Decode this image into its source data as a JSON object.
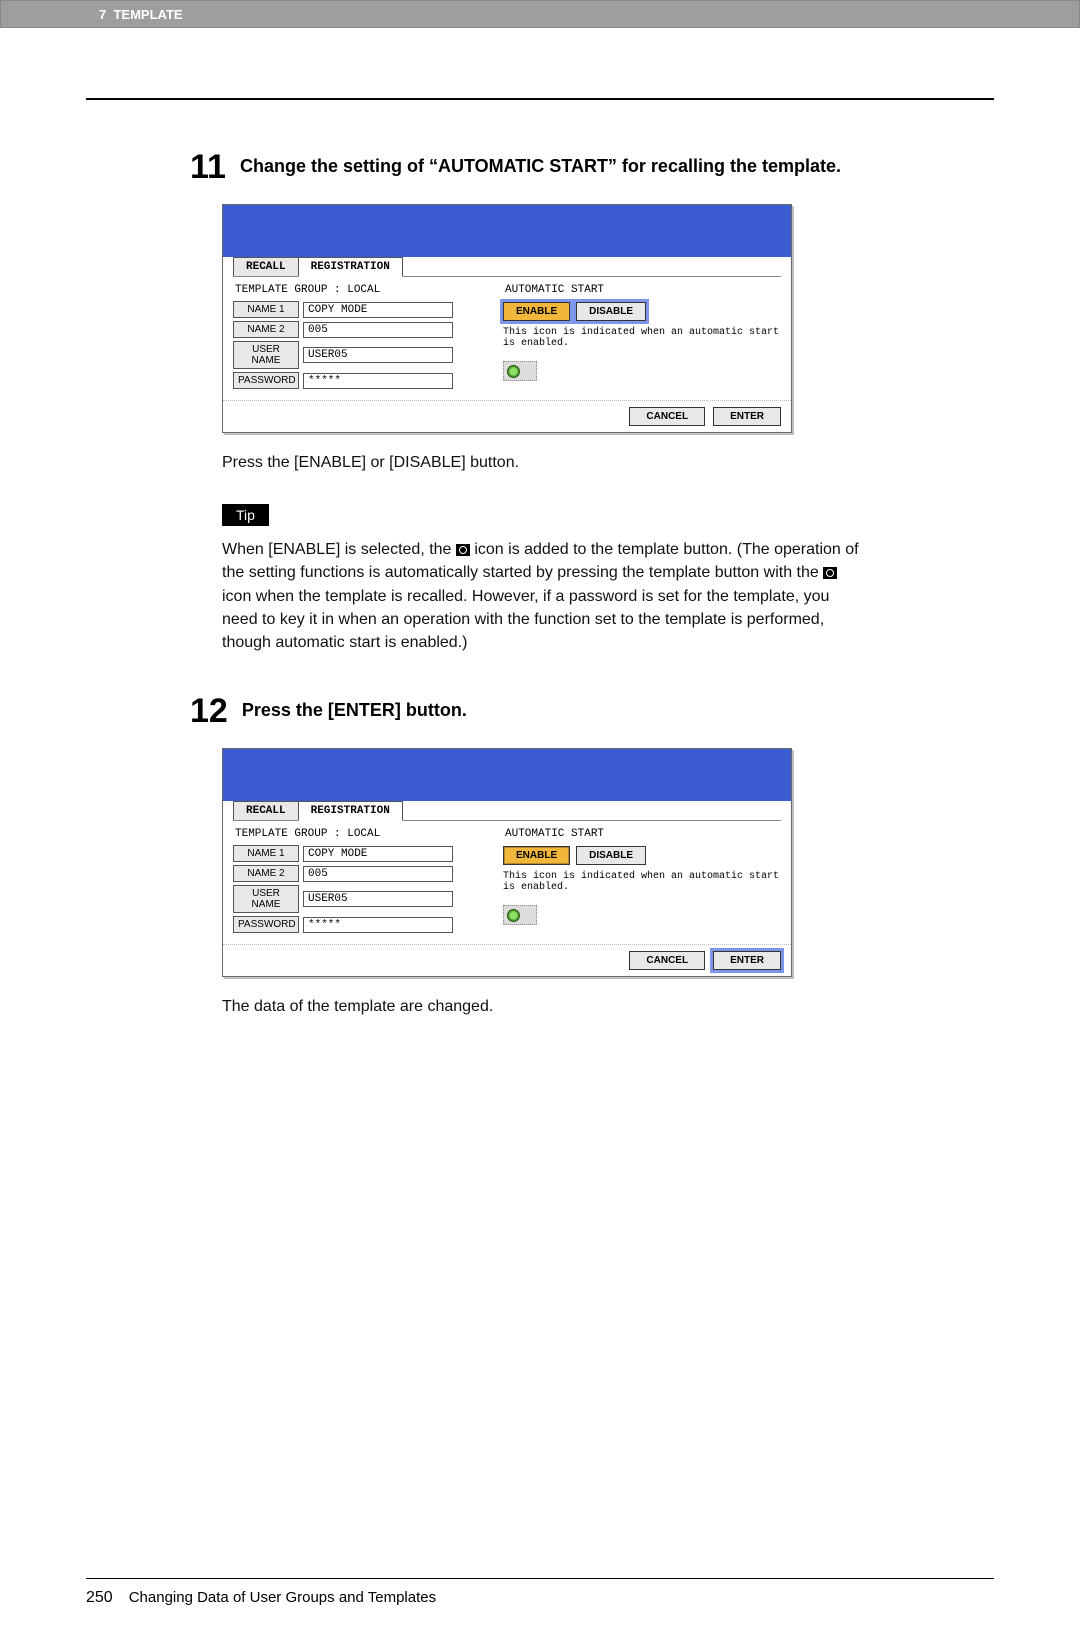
{
  "header": {
    "chapter_num": "7",
    "chapter_title": "TEMPLATE"
  },
  "step11": {
    "number": "11",
    "text": "Change the setting of “AUTOMATIC START” for recalling the template."
  },
  "step12": {
    "number": "12",
    "text": "Press the [ENTER] button."
  },
  "panel": {
    "tabs": {
      "recall": "RECALL",
      "registration": "REGISTRATION"
    },
    "group_label": "TEMPLATE GROUP   : LOCAL",
    "rows": {
      "name1_label": "NAME 1",
      "name1_value": "COPY MODE",
      "name2_label": "NAME 2",
      "name2_value": "005",
      "user_label": "USER NAME",
      "user_value": "USER05",
      "pass_label": "PASSWORD",
      "pass_value": "*****"
    },
    "auto_start_label": "AUTOMATIC START",
    "enable_btn": "ENABLE",
    "disable_btn": "DISABLE",
    "note": "This icon is indicated when an automatic start is enabled.",
    "cancel_btn": "CANCEL",
    "enter_btn": "ENTER"
  },
  "after11": "Press the [ENABLE] or [DISABLE] button.",
  "tip_label": "Tip",
  "tip_text_1": "When [ENABLE] is selected, the ",
  "tip_text_2": " icon is added to the template button. (The operation of the setting functions is automatically started by pressing the template button with the ",
  "tip_text_3": " icon when the template is recalled. However, if a password is set for the template, you need to key it in when an operation with the function set to the template is performed, though automatic start is enabled.)",
  "after12": "The data of the template are changed.",
  "footer": {
    "page_number": "250",
    "section_title": "Changing Data of User Groups and Templates"
  }
}
